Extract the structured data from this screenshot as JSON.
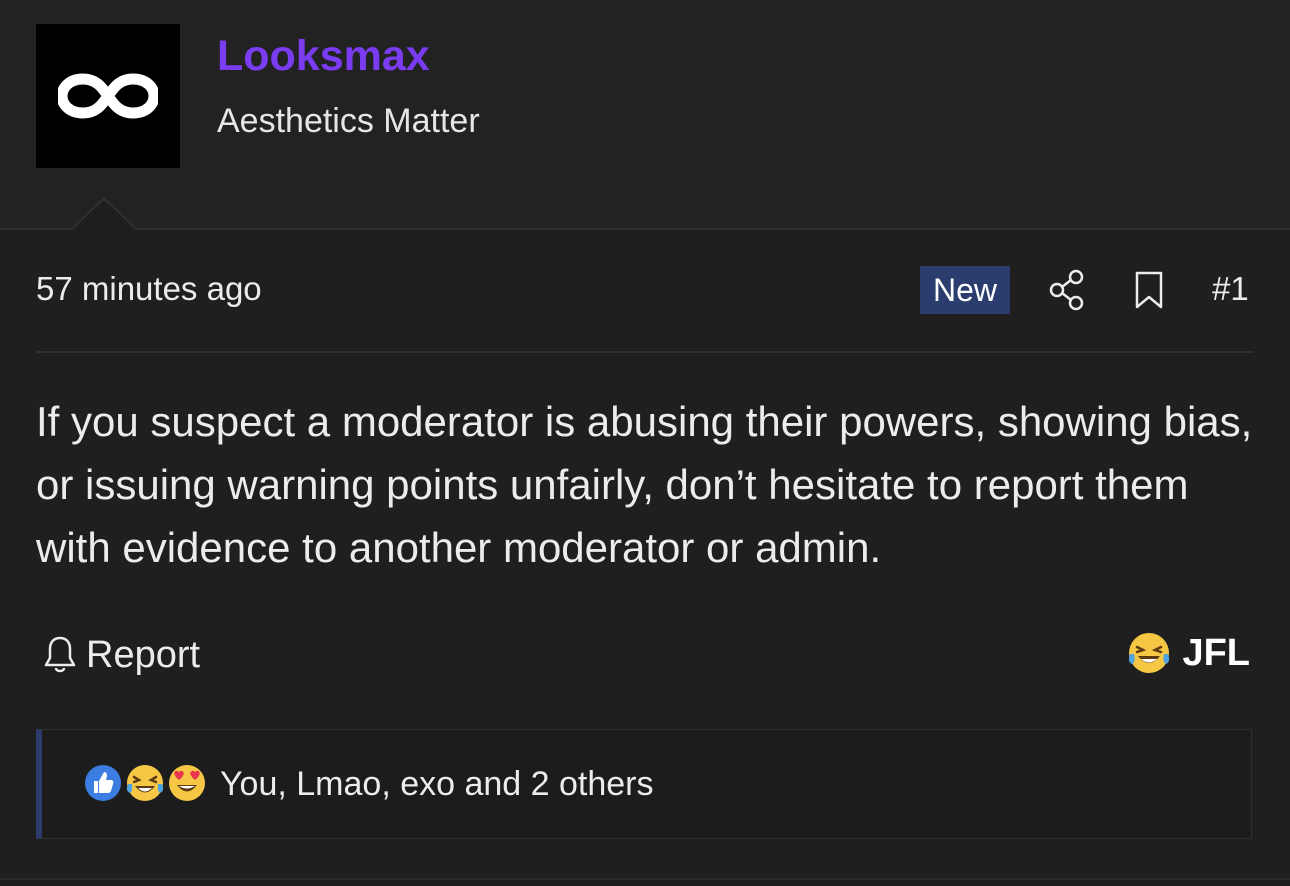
{
  "user": {
    "name": "Looksmax",
    "title": "Aesthetics Matter",
    "avatar_icon": "infinity-logo-icon"
  },
  "post": {
    "time": "57 minutes ago",
    "badge": "New",
    "number": "#1",
    "message": "If you suspect a moderator is abusing their powers, showing bias, or issuing warning points unfairly, don’t hesitate to report them with evidence to another moderator or admin.",
    "actions": {
      "report_label": "Report",
      "reaction_label": "JFL"
    },
    "reactions": {
      "summary": "You, Lmao, exo and 2 others",
      "icons": [
        "like-icon",
        "laughing-crying-icon",
        "heart-eyes-icon"
      ]
    }
  },
  "colors": {
    "username": "#7a3cf0",
    "badge_bg": "#2b3d6e",
    "background": "#1f1f20"
  }
}
